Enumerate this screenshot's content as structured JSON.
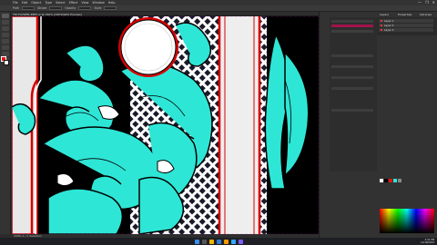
{
  "app": {
    "menu": [
      "File",
      "Edit",
      "Object",
      "Type",
      "Select",
      "Effect",
      "View",
      "Window",
      "Help"
    ],
    "window_controls": [
      "—",
      "❐",
      "✕"
    ]
  },
  "control_bar": {
    "items": [
      "Path",
      "Stroke",
      "Opacity",
      "Style"
    ]
  },
  "document": {
    "tab_label": "TRI-FLOWER-4883.ai @ 150% (CMYK/GPU Preview)",
    "status": "150%  1 / 1  Selection"
  },
  "panels": {
    "tabs": [
      "Layers",
      "Properties",
      "Libraries"
    ],
    "layers": [
      {
        "name": "Layer 1"
      },
      {
        "name": "Layer 2"
      },
      {
        "name": "Layer 3"
      }
    ]
  },
  "colors": {
    "teal": "#2ee6d6",
    "red": "#d40000",
    "black": "#000000",
    "panel": "#323232"
  },
  "taskbar": {
    "clock_time": "3:41 PM",
    "clock_date": "12/18/2023"
  }
}
